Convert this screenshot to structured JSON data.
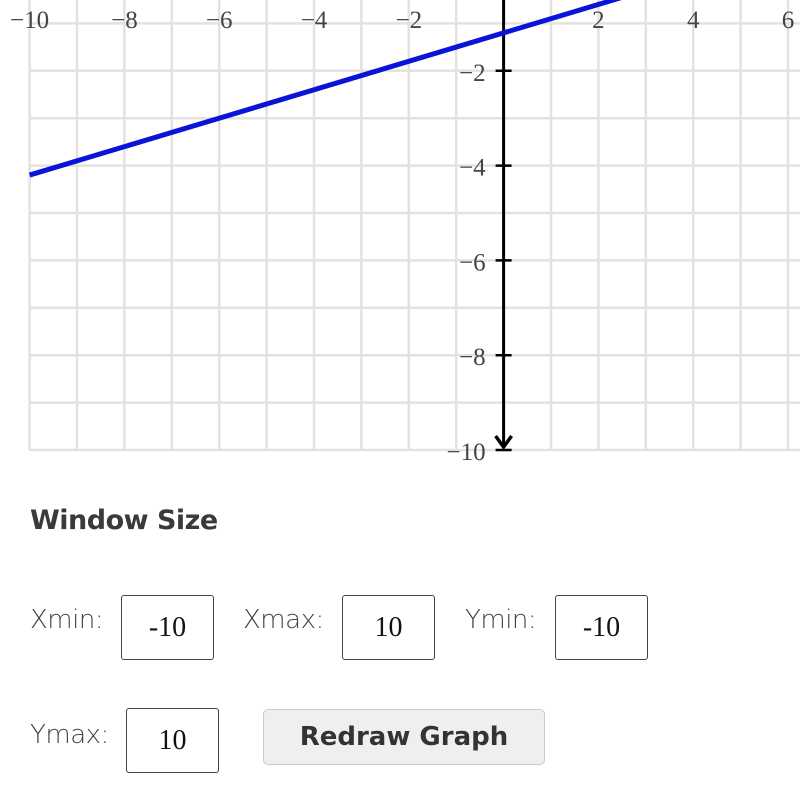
{
  "graph": {
    "x_tick_labels": [
      "−10",
      "−8",
      "−6",
      "−4",
      "−2",
      "2",
      "4",
      "6"
    ],
    "y_tick_labels": [
      "−2",
      "−4",
      "−6",
      "−8",
      "−10"
    ],
    "line_color": "#0a14d9"
  },
  "chart_data": {
    "type": "line",
    "xlim": [
      -10,
      10
    ],
    "ylim": [
      -10,
      10
    ],
    "grid": true,
    "series": [
      {
        "x": [
          -10,
          2.5
        ],
        "y": [
          -4.2,
          -0.45
        ]
      }
    ]
  },
  "window_size": {
    "title": "Window Size",
    "xmin_label": "Xmin:",
    "xmin_value": "-10",
    "xmax_label": "Xmax:",
    "xmax_value": "10",
    "ymin_label": "Ymin:",
    "ymin_value": "-10",
    "ymax_label": "Ymax:",
    "ymax_value": "10",
    "redraw_label": "Redraw Graph"
  }
}
